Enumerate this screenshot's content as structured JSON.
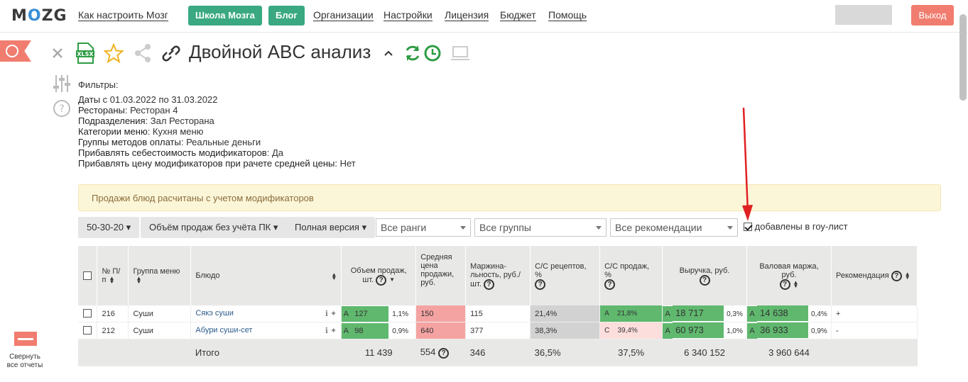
{
  "nav": {
    "logo": "MOZG",
    "links": [
      "Как настроить Мозг",
      "Организации",
      "Настройки",
      "Лицензия",
      "Бюджет",
      "Помощь"
    ],
    "school_btn": "Школа Мозга",
    "blog_btn": "Блог",
    "logout": "Выход"
  },
  "report": {
    "title": "Двойной ABC анализ",
    "xlsx": "XLSX"
  },
  "filters": {
    "heading": "Фильтры:",
    "rows": [
      {
        "k": "Даты",
        "v": " с 01.03.2022 по 31.03.2022"
      },
      {
        "k": "Рестораны",
        "v": ": Ресторан 4"
      },
      {
        "k": "Подразделения",
        "v": ": Зал Ресторана"
      },
      {
        "k": "Категории меню",
        "v": ": Кухня меню"
      },
      {
        "k": "Группы методов оплаты",
        "v": ": Реальные деньги"
      },
      {
        "k": "Прибавлять себестоимость модификаторов",
        "v": ": Да"
      },
      {
        "k": "Прибавлять цену модификаторов при рачете средней цены",
        "v": ": Нет"
      }
    ]
  },
  "notice": "Продажи блюд расчитаны с учетом модификаторов",
  "toolbar": {
    "btn1": "50-30-20",
    "btn2": "Объём продаж без учёта ПК",
    "btn3": "Полная версия",
    "sel1": "Все ранги",
    "sel2": "Все группы",
    "sel3": "Все рекомендации",
    "goo": "добавлены в гоу-лист"
  },
  "table": {
    "headers": {
      "num": "№ П/п",
      "group": "Группа меню",
      "dish": "Блюдо",
      "volume": "Объем продаж, шт.",
      "avg": "Средняя цена продажи, руб.",
      "margin_unit": "Маржина-льность, руб./шт.",
      "cc_recipe": "С/С рецептов, %",
      "cc_sales": "С/С продаж, %",
      "revenue": "Выручка, руб.",
      "gross": "Валовая маржа, руб.",
      "rec": "Рекомендация"
    },
    "rows": [
      {
        "n": "216",
        "group": "Суши",
        "dish": "Сякэ суши",
        "vr": "A",
        "vol": "127",
        "volp": "1,1%",
        "avg": "150",
        "marg": "115",
        "ccr": "21,4%",
        "csr": "A",
        "ccs": "21,8%",
        "rr": "A",
        "rev": "18 717",
        "revp": "0,3%",
        "gr": "A",
        "gm": "14 638",
        "gmp": "0,4%",
        "rec": "+"
      },
      {
        "n": "212",
        "group": "Суши",
        "dish": "Абури суши-сет",
        "vr": "A",
        "vol": "98",
        "volp": "0,9%",
        "avg": "640",
        "marg": "377",
        "ccr": "38,3%",
        "csr": "C",
        "ccs": "39,4%",
        "rr": "A",
        "rev": "60 973",
        "revp": "1,0%",
        "gr": "A",
        "gm": "36 933",
        "gmp": "0,9%",
        "rec": "-"
      }
    ],
    "footer": {
      "label": "Итого",
      "vol": "11 439",
      "avg": "554",
      "marg": "346",
      "ccr": "36,5%",
      "ccs": "37,5%",
      "rev": "6 340 152",
      "gm": "3 960 644"
    }
  },
  "collapse_label": "Свернуть все отчеты"
}
